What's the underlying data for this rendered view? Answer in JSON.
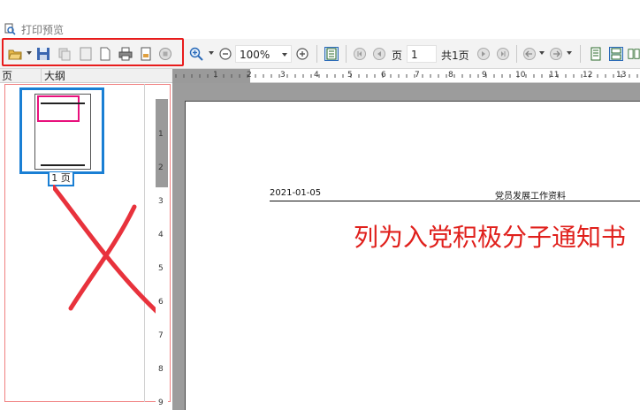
{
  "window": {
    "title": "打印预览"
  },
  "toolbar": {
    "zoom_value": "100%",
    "page_label": "页",
    "page_value": "1",
    "total_label": "共1页"
  },
  "tabs": [
    {
      "label": "页"
    },
    {
      "label": "大纲"
    }
  ],
  "thumbnail": {
    "caption": "1 页"
  },
  "ruler": {
    "h_numbers": [
      "1",
      "2",
      "3",
      "4",
      "5",
      "6",
      "7",
      "8",
      "9",
      "10",
      "11",
      "12",
      "13"
    ],
    "v_numbers": [
      "1",
      "2",
      "3",
      "4",
      "5",
      "6",
      "7",
      "8",
      "9"
    ]
  },
  "document": {
    "header_date": "2021-01-05",
    "header_title": "党员发展工作资料",
    "heading": "列为入党积极分子通知书"
  },
  "colors": {
    "highlight_red": "#e81c1c",
    "selection_blue": "#1a7fd4",
    "heading_red": "#e0201c"
  }
}
